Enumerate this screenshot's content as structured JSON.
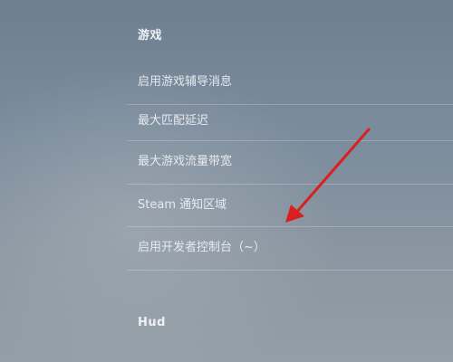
{
  "sections": {
    "game": {
      "header": "游戏",
      "items": [
        {
          "label": "启用游戏辅导消息"
        },
        {
          "label": "最大匹配延迟"
        },
        {
          "label": "最大游戏流量带宽"
        },
        {
          "label": "Steam 通知区域"
        },
        {
          "label": "启用开发者控制台（~）"
        }
      ]
    },
    "hud": {
      "header": "Hud"
    }
  },
  "annotation": {
    "arrow_color": "#d91f1f"
  }
}
